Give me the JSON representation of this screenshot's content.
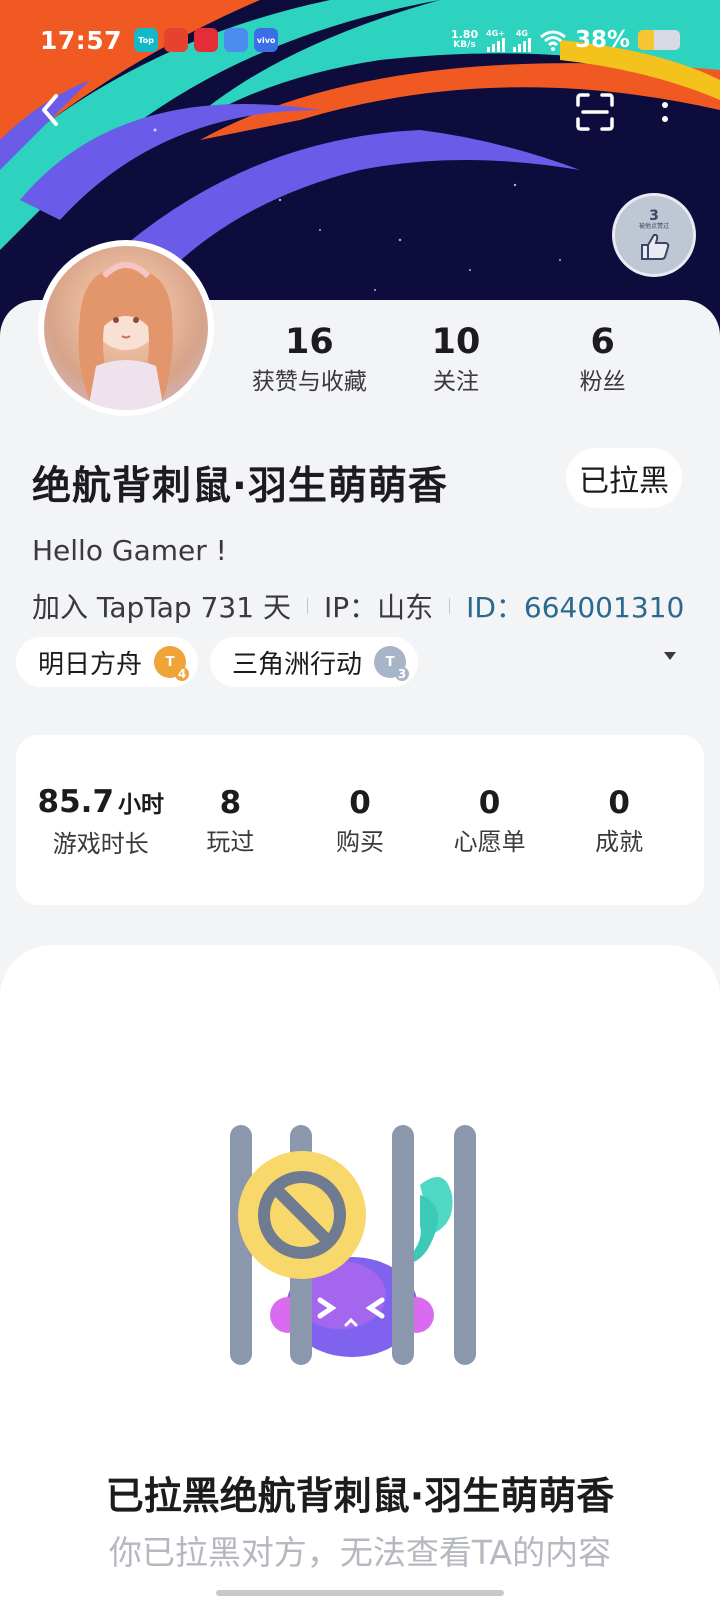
{
  "status_bar": {
    "time": "17:57",
    "apps": [
      {
        "name": "taptap-app-icon",
        "label": "Top",
        "color": "#14b9c8"
      },
      {
        "name": "app-icon-red",
        "label": "",
        "color": "#e5432d"
      },
      {
        "name": "video-app-icon",
        "label": "",
        "color": "#e52d3a"
      },
      {
        "name": "app-icon-blue",
        "label": "",
        "color": "#4a8cf0"
      },
      {
        "name": "vivo-app-icon",
        "label": "vivo",
        "color": "#3a6fe8"
      }
    ],
    "net_speed_value": "1.80",
    "net_speed_unit": "KB/s",
    "signal1_label": "4G+",
    "signal2_label": "4G",
    "battery_text": "38%",
    "battery_level": 0.38
  },
  "header": {
    "back_icon": "chevron-left-icon",
    "scan_icon": "scan-icon",
    "more_icon": "more-vertical-icon",
    "like_badge": {
      "count": "3",
      "text": "被他点赞过"
    }
  },
  "profile": {
    "stats": [
      {
        "value": "16",
        "label": "获赞与收藏"
      },
      {
        "value": "10",
        "label": "关注"
      },
      {
        "value": "6",
        "label": "粉丝"
      }
    ],
    "username": "绝航背刺鼠·羽生萌萌香",
    "blocked_button": "已拉黑",
    "bio": "Hello Gamer !",
    "joined": "加入 TapTap 731 天",
    "ip": "IP：山东",
    "id_text": "ID：664001310",
    "tags": [
      {
        "label": "明日方舟",
        "level": "4",
        "badge": "gold"
      },
      {
        "label": "三角洲行动",
        "level": "3",
        "badge": "silver"
      }
    ]
  },
  "game_stats": {
    "playtime_value": "85.7",
    "playtime_unit": "小时",
    "playtime_label": "游戏时长",
    "items": [
      {
        "value": "8",
        "label": "玩过"
      },
      {
        "value": "0",
        "label": "购买"
      },
      {
        "value": "0",
        "label": "心愿单"
      },
      {
        "value": "0",
        "label": "成就"
      }
    ]
  },
  "blocked_notice": {
    "title": "已拉黑绝航背刺鼠·羽生萌萌香",
    "subtitle": "你已拉黑对方，无法查看TA的内容"
  },
  "colors": {
    "banner_bg": "#0d0c3c",
    "accent_id": "#2b6a8e",
    "muted_text": "#b5b8bf"
  }
}
